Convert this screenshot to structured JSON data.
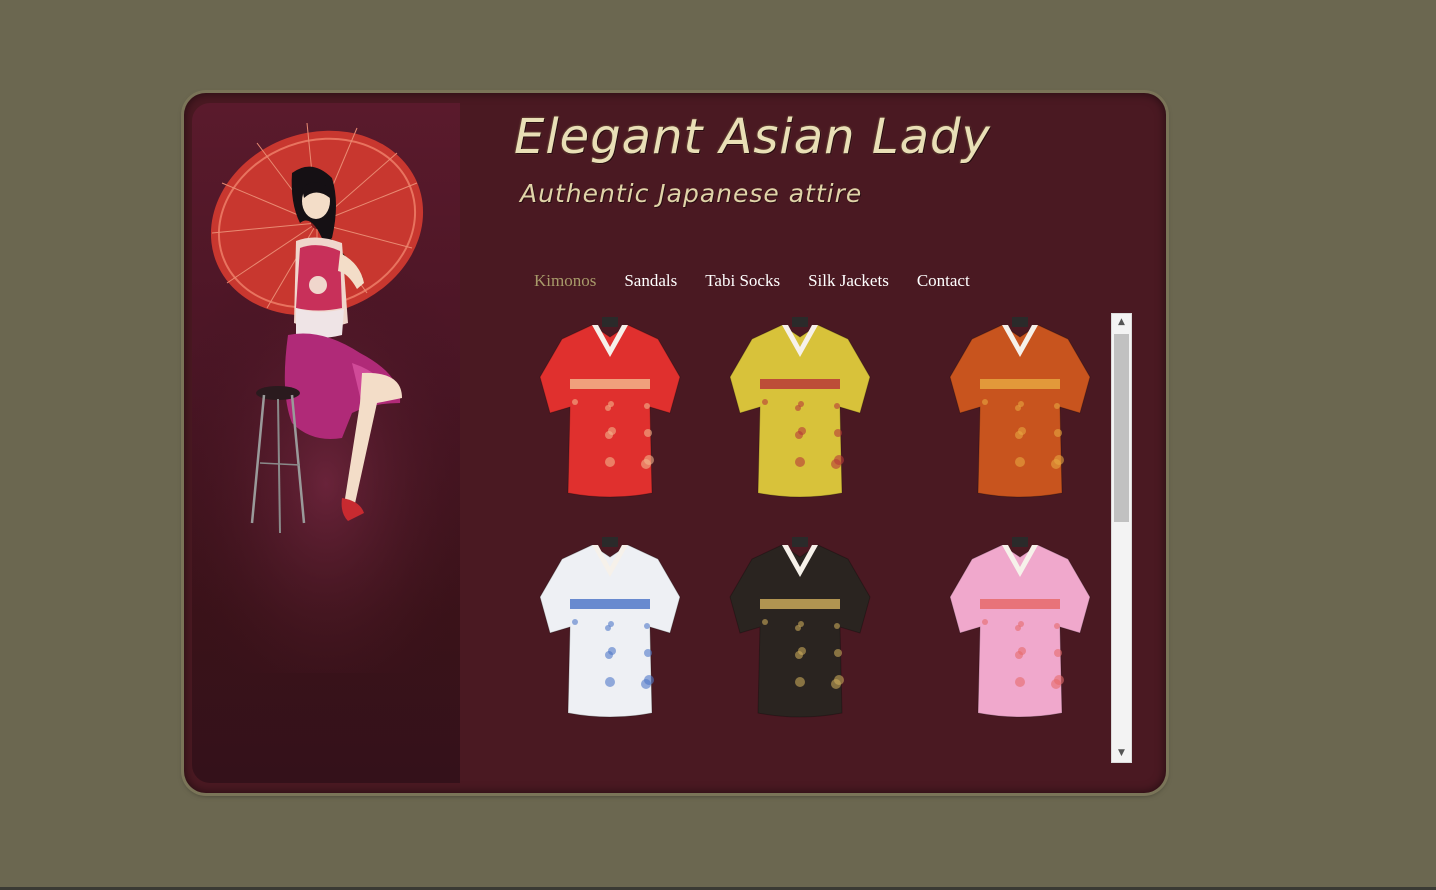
{
  "site": {
    "title": "Elegant Asian Lady",
    "subtitle": "Authentic Japanese attire"
  },
  "nav": {
    "items": [
      {
        "label": "Kimonos",
        "active": true
      },
      {
        "label": "Sandals",
        "active": false
      },
      {
        "label": "Tabi Socks",
        "active": false
      },
      {
        "label": "Silk Jackets",
        "active": false
      },
      {
        "label": "Contact",
        "active": false
      }
    ]
  },
  "gallery": {
    "items": [
      {
        "name": "red-floral-kimono",
        "color": "#e0302e",
        "accent": "#f2b48a"
      },
      {
        "name": "yellow-kimono",
        "color": "#d8c23a",
        "accent": "#b83838"
      },
      {
        "name": "orange-brocade-kimono",
        "color": "#c8541e",
        "accent": "#e6a640"
      },
      {
        "name": "white-blue-yukata",
        "color": "#eef0f4",
        "accent": "#5078c8"
      },
      {
        "name": "black-gold-kimono",
        "color": "#2a2420",
        "accent": "#c8a85a"
      },
      {
        "name": "pink-floral-kimono",
        "color": "#f0a8cc",
        "accent": "#e66a6a"
      }
    ]
  },
  "colors": {
    "background": "#6b6750",
    "frame": "#4a1922",
    "nav_active": "#a89a6a",
    "title": "#e9dfb6"
  }
}
